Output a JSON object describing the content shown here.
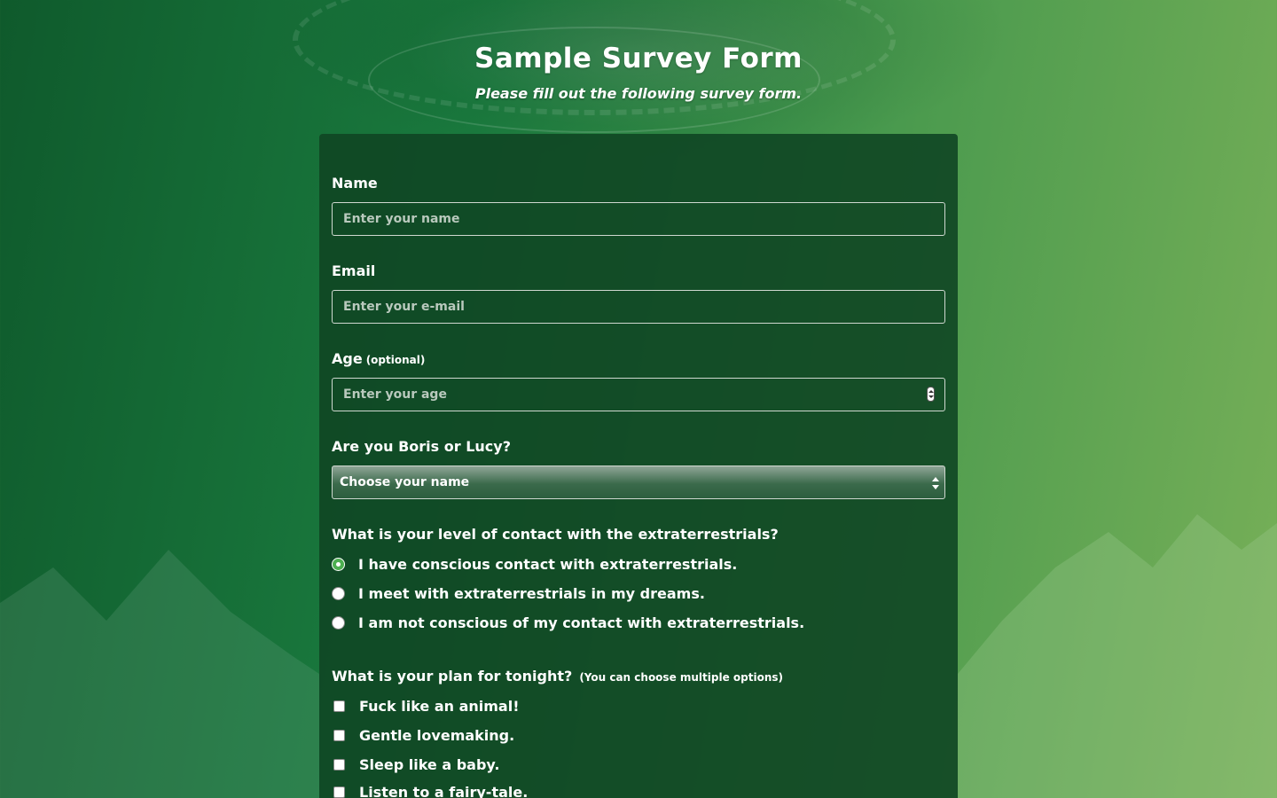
{
  "header": {
    "title": "Sample Survey Form",
    "subtitle": "Please fill out the following survey form."
  },
  "form": {
    "name": {
      "label": "Name",
      "placeholder": "Enter your name",
      "value": ""
    },
    "email": {
      "label": "Email",
      "placeholder": "Enter your e-mail",
      "value": ""
    },
    "age": {
      "label": "Age",
      "hint": "(optional)",
      "placeholder": "Enter your age",
      "value": ""
    },
    "identity": {
      "label": "Are you Boris or Lucy?",
      "selected": "Choose your name"
    },
    "contact": {
      "label": "What is your level of contact with the extraterrestrials?",
      "options": [
        {
          "label": "I have conscious contact with extraterrestrials.",
          "checked": true
        },
        {
          "label": "I meet with extraterrestrials in my dreams.",
          "checked": false
        },
        {
          "label": "I am not conscious of my contact with extraterrestrials.",
          "checked": false
        }
      ]
    },
    "plans": {
      "label": "What is your plan for tonight?",
      "hint": "(You can choose multiple options)",
      "options": [
        {
          "label": "Fuck like an animal!",
          "checked": false
        },
        {
          "label": "Gentle lovemaking.",
          "checked": false
        },
        {
          "label": "Sleep like a baby.",
          "checked": false
        },
        {
          "label": "Listen to a fairy-tale.",
          "checked": false
        }
      ]
    }
  },
  "colors": {
    "card_bg": "#0f4623",
    "accent_green": "#4caf50",
    "background_left": "#0f5a2c",
    "background_right": "#78b058"
  }
}
